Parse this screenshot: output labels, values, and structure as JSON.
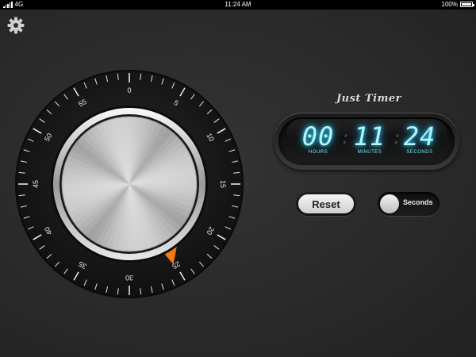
{
  "status_bar": {
    "network": "4G",
    "time": "11:24 AM",
    "battery_text": "100%",
    "battery_level": 1.0
  },
  "settings": {
    "icon": "gear-icon"
  },
  "dial": {
    "labels": [
      "0",
      "5",
      "10",
      "15",
      "20",
      "25",
      "30",
      "35",
      "40",
      "45",
      "50",
      "55"
    ],
    "pointer_color": "#f27a12",
    "pointer_position_minutes": 25
  },
  "brand": {
    "name": "Just Timer"
  },
  "display": {
    "hours": "00",
    "minutes": "11",
    "seconds": "24",
    "hours_label": "Hours",
    "minutes_label": "Minutes",
    "seconds_label": "Seconds"
  },
  "controls": {
    "reset_label": "Reset",
    "seconds_toggle_label": "Seconds"
  },
  "colors": {
    "digit_glow": "#aef7ff",
    "accent": "#f27a12"
  }
}
